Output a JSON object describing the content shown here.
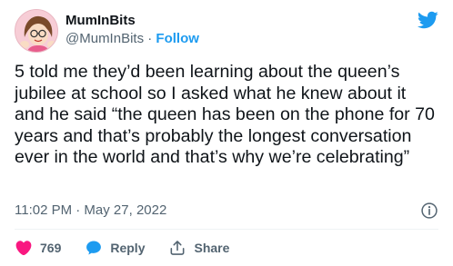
{
  "user": {
    "display_name": "MumInBits",
    "handle": "@MumInBits",
    "separator": "·",
    "follow_label": "Follow"
  },
  "tweet": {
    "text": "5 told me they’d been learning about the queen’s jubilee at school so I asked what he knew about it and he said “the queen has been on the phone for 70 years and that’s probably the longest conversation ever in the world and that’s why we’re celebrating”",
    "timestamp": "11:02 PM · May 27, 2022"
  },
  "actions": {
    "like_count": "769",
    "reply_label": "Reply",
    "share_label": "Share"
  },
  "icons": {
    "brand": "twitter-bird-icon",
    "info": "info-icon",
    "like": "heart-icon",
    "reply": "speech-bubble-icon",
    "share": "share-upload-icon"
  },
  "colors": {
    "brand_blue": "#1d9bf0",
    "like_pink": "#f91880",
    "text_primary": "#0f1419",
    "text_secondary": "#536471",
    "divider": "#eff3f4"
  }
}
